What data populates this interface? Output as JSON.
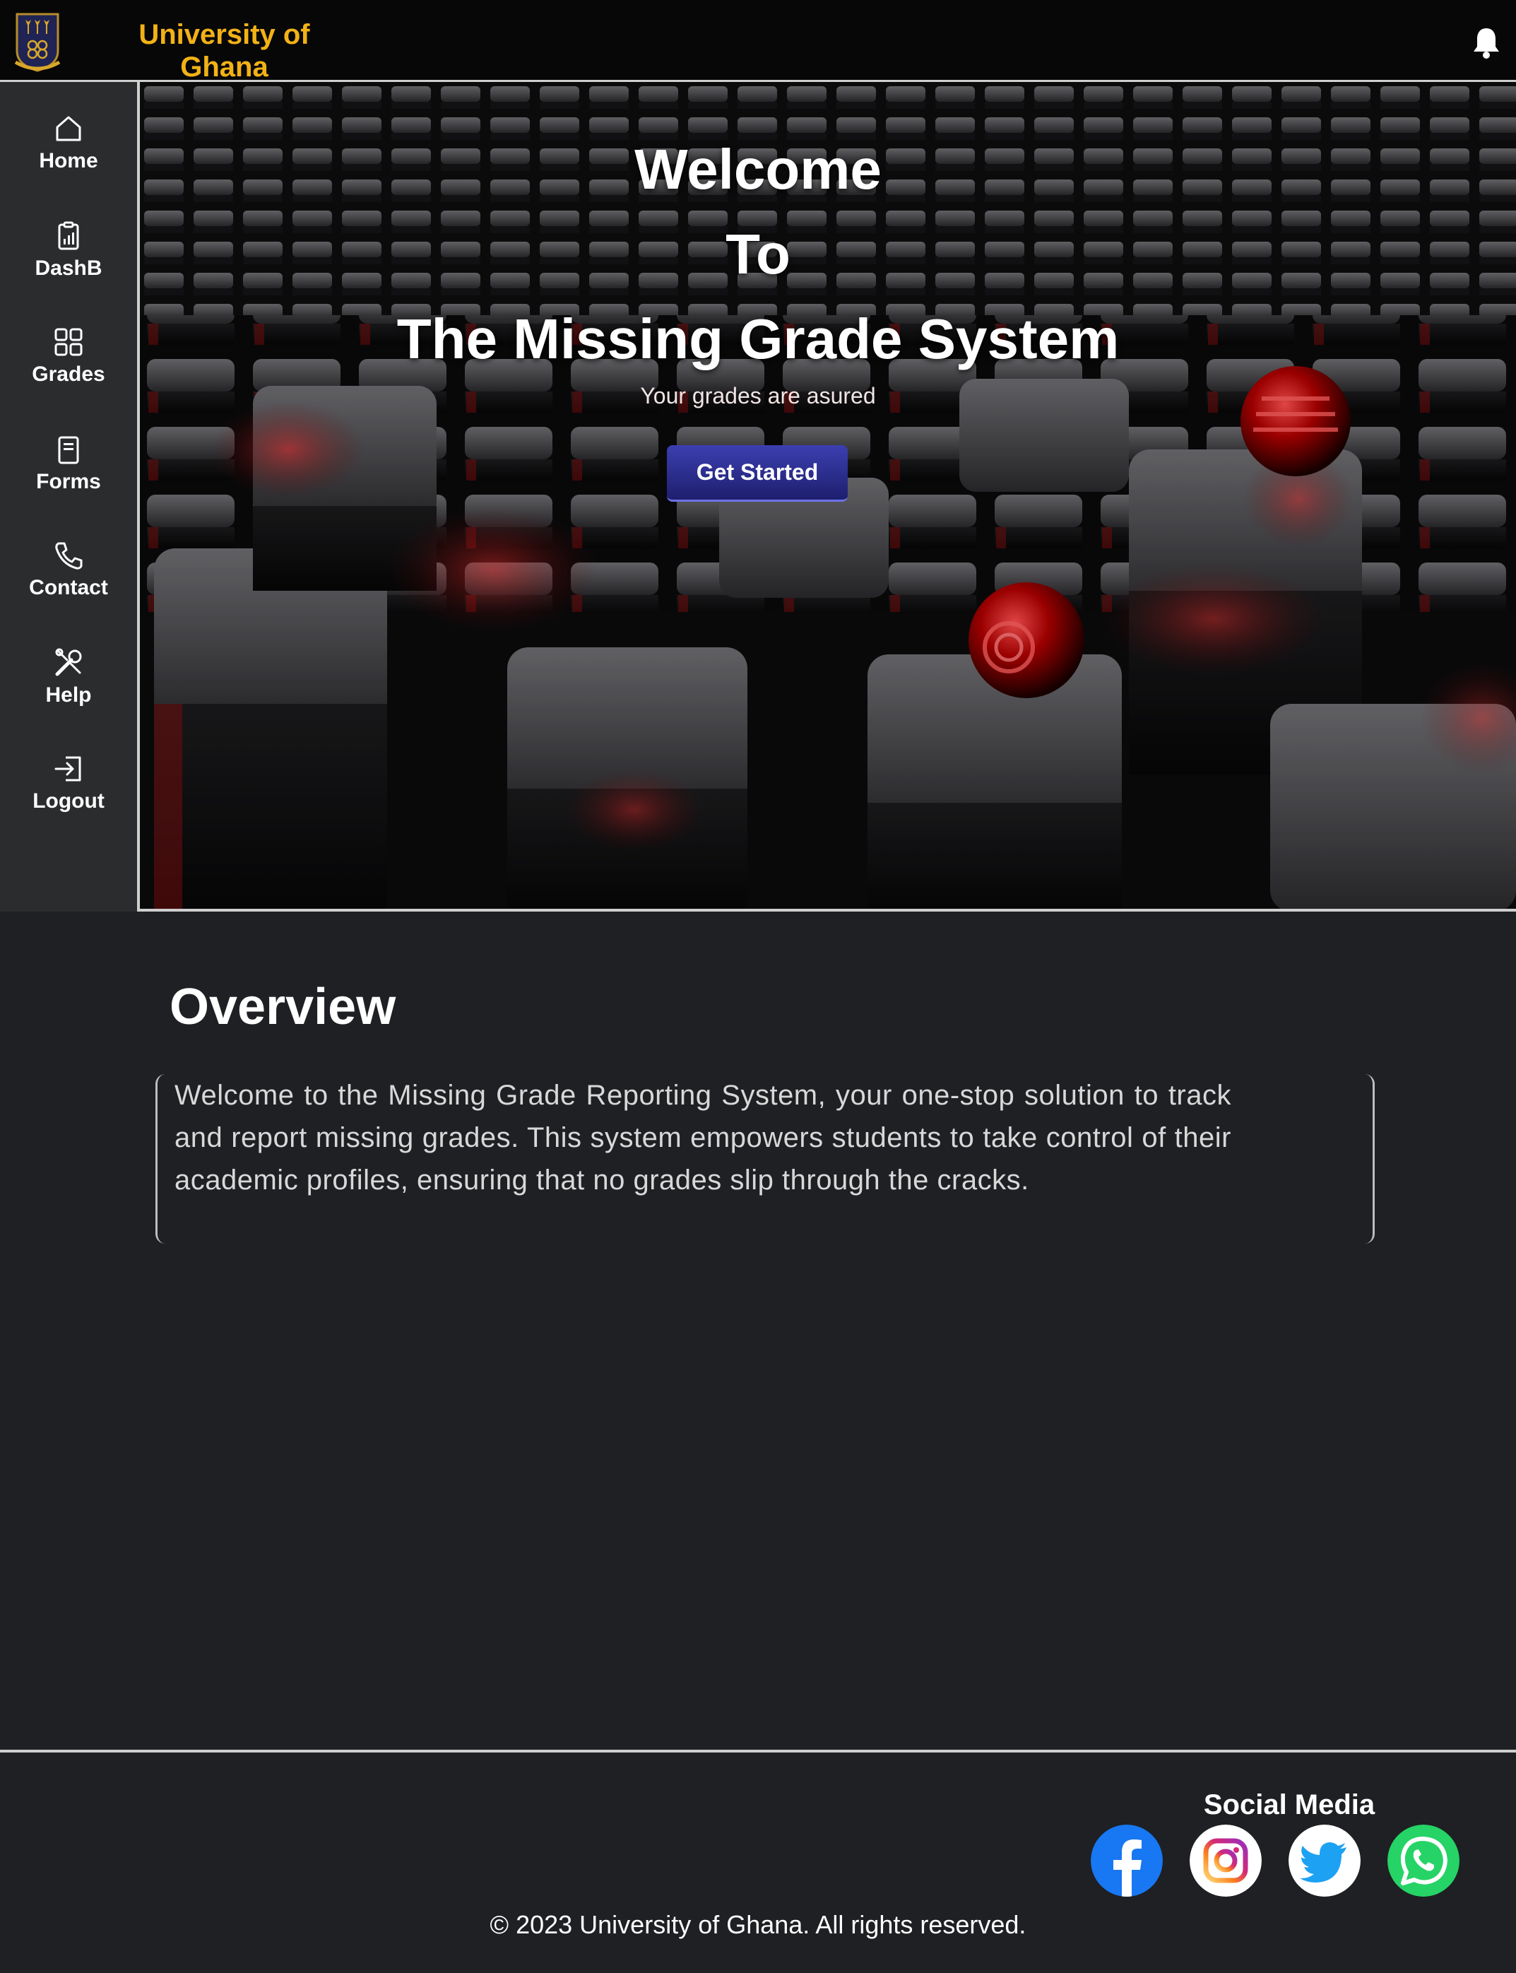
{
  "header": {
    "brand_line1": "University of",
    "brand_line2": "Ghana",
    "notification_icon": "bell-icon"
  },
  "sidebar": {
    "items": [
      {
        "label": "Home",
        "icon": "home-icon"
      },
      {
        "label": "DashB",
        "icon": "dashboard-icon"
      },
      {
        "label": "Grades",
        "icon": "grid-icon"
      },
      {
        "label": "Forms",
        "icon": "form-icon"
      },
      {
        "label": "Contact",
        "icon": "phone-icon"
      },
      {
        "label": "Help",
        "icon": "tools-icon"
      },
      {
        "label": "Logout",
        "icon": "logout-icon"
      }
    ]
  },
  "hero": {
    "line1": "Welcome",
    "line2": "To",
    "line3": "The Missing Grade System",
    "subtitle": "Your grades are asured",
    "cta_label": "Get Started"
  },
  "overview": {
    "title": "Overview",
    "body": "Welcome to the Missing Grade Reporting System, your one-stop solution to track and report missing grades. This system empowers students to take control of their academic profiles, ensuring that no grades slip through the cracks."
  },
  "footer": {
    "social_title": "Social Media",
    "social_links": [
      "facebook-icon",
      "instagram-icon",
      "twitter-icon",
      "whatsapp-icon"
    ],
    "copyright": "© 2023 University of Ghana. All rights reserved."
  },
  "colors": {
    "brand": "#f2b216",
    "header_bg": "#070707",
    "sidebar_bg": "#2b2c2e",
    "page_bg": "#1e2023",
    "cta": "#2d2f92"
  }
}
